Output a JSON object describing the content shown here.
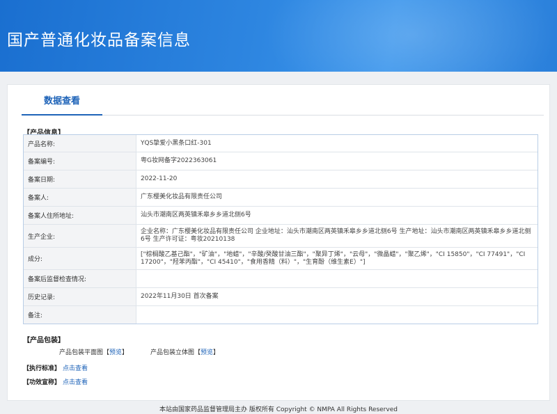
{
  "header": {
    "title": "国产普通化妆品备案信息"
  },
  "tabs": [
    {
      "label": "数据查看"
    }
  ],
  "product_info": {
    "section_title": "【产品信息】",
    "rows": [
      {
        "label": "产品名称:",
        "value": "YQS挚爱小黑条口红-301"
      },
      {
        "label": "备案编号:",
        "value": "粤G妆网备字2022363061"
      },
      {
        "label": "备案日期:",
        "value": "2022-11-20"
      },
      {
        "label": "备案人:",
        "value": "广东樱美化妆品有限责任公司"
      },
      {
        "label": "备案人住所地址:",
        "value": "汕头市潮南区两英镇禾皋乡乡道北侧6号"
      },
      {
        "label": "生产企业:",
        "value": "企业名称：广东樱美化妆品有限责任公司 企业地址：汕头市潮南区两英镇禾皋乡乡道北侧6号 生产地址：汕头市潮南区两英镇禾皋乡乡道北侧6号 生产许可证：粤妆20210138"
      },
      {
        "label": "成分:",
        "value": "[\"棕榈酸乙基己酯\"，\"矿油\"，\"地蜡\"，\"辛酸/癸酸甘油三酯\"，\"聚异丁烯\"，\"云母\"，\"微晶蜡\"，\"聚乙烯\"，\"CI 15850\"，\"CI 77491\"，\"CI 17200\"，\"羟苯丙酯\"，\"CI 45410\"，\"食用香精（料）\"，\"生育酚（维生素E）\"]"
      },
      {
        "label": "备案后监督检查情况:",
        "value": ""
      },
      {
        "label": "历史记录:",
        "value": "2022年11月30日 首次备案"
      },
      {
        "label": "备注:",
        "value": ""
      }
    ]
  },
  "packaging": {
    "section_title": "【产品包装】",
    "plane_label": "产品包装平面图",
    "stereo_label": "产品包装立体图",
    "bracket_open": "【",
    "bracket_close": "】",
    "preview_label": "预览"
  },
  "standard": {
    "label": "【执行标准】",
    "link": "点击查看"
  },
  "efficacy": {
    "label": "【功效宣称】",
    "link": "点击查看"
  },
  "footer": {
    "text": "本站由国家药品监督管理局主办 版权所有 Copyright © NMPA All Rights Reserved"
  }
}
